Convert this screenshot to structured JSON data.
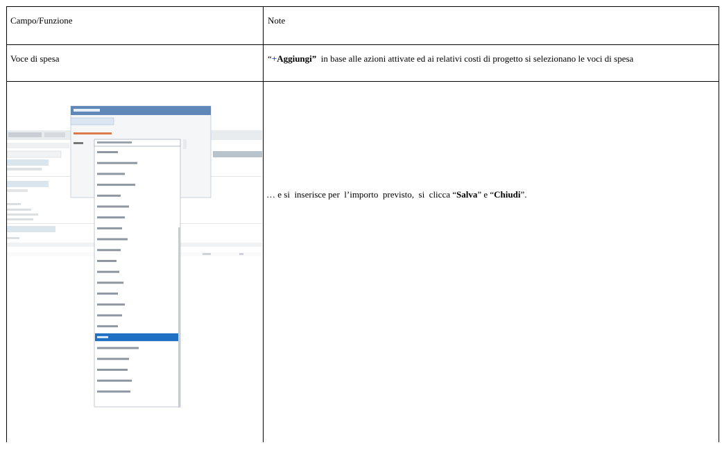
{
  "table": {
    "header": {
      "col1": "Campo/Funzione",
      "col2": "Note"
    },
    "row_voce": {
      "field": "Voce di spesa",
      "note_open_quote": "“",
      "note_plus": "+",
      "note_bold": "Aggiungi”",
      "note_rest": "  in base alle azioni attivate ed ai relativi costi di progetto si selezionano le voci di spesa"
    },
    "row_screenshot": {
      "caption_a": "… e si  inserisce per  l’importo  previsto,  si  clicca “",
      "caption_salva": "Salva",
      "caption_b": "” e “",
      "caption_chiudi": "Chiudi",
      "caption_c": "”."
    }
  },
  "colors": {
    "selection": "#1f6fc4",
    "link_plus": "#1f4fd6"
  }
}
